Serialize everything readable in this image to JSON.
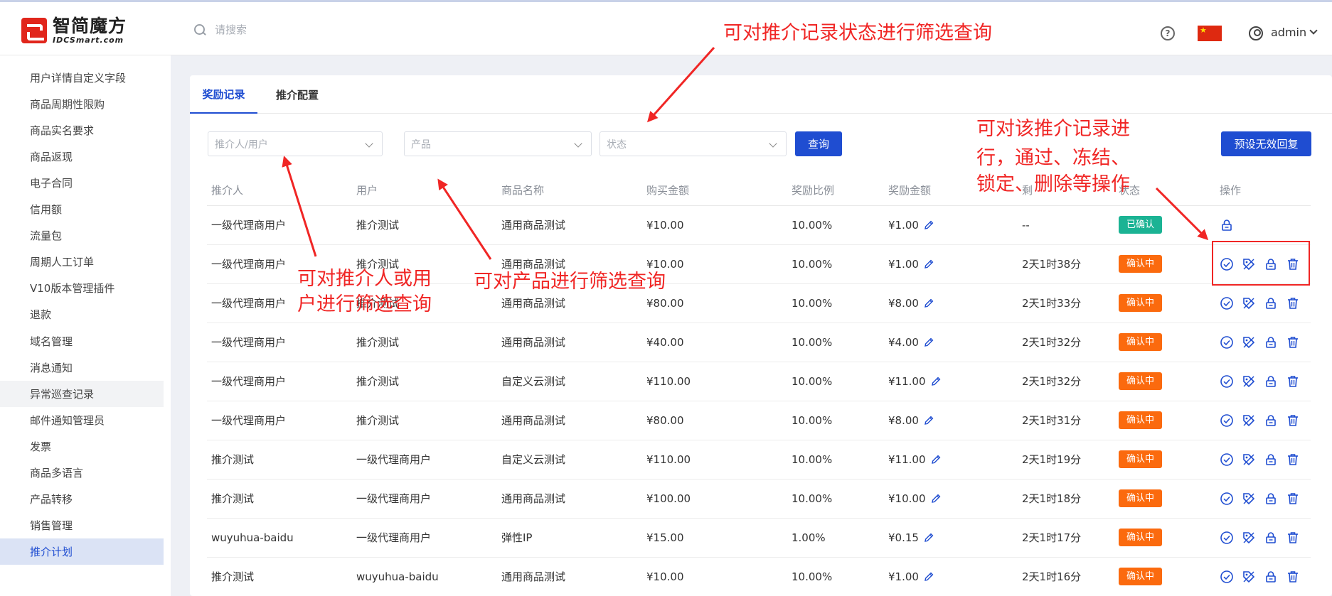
{
  "brand": {
    "name_cn": "智简魔方",
    "name_en": "IDCSmart.com"
  },
  "search": {
    "placeholder": "请搜索"
  },
  "header": {
    "username": "admin",
    "help_icon": "question-circle-icon",
    "language_flag": "china-flag-icon"
  },
  "sidebar": {
    "items": [
      {
        "label": "用户详情自定义字段"
      },
      {
        "label": "商品周期性限购"
      },
      {
        "label": "商品实名要求"
      },
      {
        "label": "商品返现"
      },
      {
        "label": "电子合同"
      },
      {
        "label": "信用额"
      },
      {
        "label": "流量包"
      },
      {
        "label": "周期人工订单"
      },
      {
        "label": "V10版本管理插件"
      },
      {
        "label": "退款"
      },
      {
        "label": "域名管理"
      },
      {
        "label": "消息通知"
      },
      {
        "label": "异常巡查记录"
      },
      {
        "label": "邮件通知管理员"
      },
      {
        "label": "发票"
      },
      {
        "label": "商品多语言"
      },
      {
        "label": "产品转移"
      },
      {
        "label": "销售管理"
      },
      {
        "label": "推介计划"
      }
    ],
    "hovered": "异常巡查记录",
    "active": "推介计划"
  },
  "tabs": [
    {
      "label": "奖励记录",
      "active": true
    },
    {
      "label": "推介配置",
      "active": false
    }
  ],
  "filters": {
    "referrer_placeholder": "推介人/用户",
    "product_placeholder": "产品",
    "status_placeholder": "状态",
    "query_button": "查询",
    "preset_button": "预设无效回复"
  },
  "table": {
    "columns": [
      "推介人",
      "用户",
      "商品名称",
      "购买金额",
      "奖励比例",
      "奖励金额",
      "剩",
      "状态",
      "操作"
    ],
    "rows": [
      {
        "referrer": "一级代理商用户",
        "user": "推介测试",
        "product": "通用商品测试",
        "amount": "¥10.00",
        "ratio": "10.00%",
        "reward": "¥1.00",
        "remaining": "--",
        "status": "已确认",
        "status_type": "ok",
        "actions": [
          "lock"
        ]
      },
      {
        "referrer": "一级代理商用户",
        "user": "推介测试",
        "product": "通用商品测试",
        "amount": "¥10.00",
        "ratio": "10.00%",
        "reward": "¥1.00",
        "remaining": "2天1时38分",
        "status": "确认中",
        "status_type": "pending",
        "actions": [
          "check",
          "tag",
          "lock",
          "trash"
        ]
      },
      {
        "referrer": "一级代理商用户",
        "user": "推介测试",
        "product": "通用商品测试",
        "amount": "¥80.00",
        "ratio": "10.00%",
        "reward": "¥8.00",
        "remaining": "2天1时33分",
        "status": "确认中",
        "status_type": "pending",
        "actions": [
          "check",
          "tag",
          "lock",
          "trash"
        ]
      },
      {
        "referrer": "一级代理商用户",
        "user": "推介测试",
        "product": "通用商品测试",
        "amount": "¥40.00",
        "ratio": "10.00%",
        "reward": "¥4.00",
        "remaining": "2天1时32分",
        "status": "确认中",
        "status_type": "pending",
        "actions": [
          "check",
          "tag",
          "lock",
          "trash"
        ]
      },
      {
        "referrer": "一级代理商用户",
        "user": "推介测试",
        "product": "自定义云测试",
        "amount": "¥110.00",
        "ratio": "10.00%",
        "reward": "¥11.00",
        "remaining": "2天1时32分",
        "status": "确认中",
        "status_type": "pending",
        "actions": [
          "check",
          "tag",
          "lock",
          "trash"
        ]
      },
      {
        "referrer": "一级代理商用户",
        "user": "推介测试",
        "product": "通用商品测试",
        "amount": "¥80.00",
        "ratio": "10.00%",
        "reward": "¥8.00",
        "remaining": "2天1时31分",
        "status": "确认中",
        "status_type": "pending",
        "actions": [
          "check",
          "tag",
          "lock",
          "trash"
        ]
      },
      {
        "referrer": "推介测试",
        "user": "一级代理商用户",
        "product": "自定义云测试",
        "amount": "¥110.00",
        "ratio": "10.00%",
        "reward": "¥11.00",
        "remaining": "2天1时19分",
        "status": "确认中",
        "status_type": "pending",
        "actions": [
          "check",
          "tag",
          "lock",
          "trash"
        ]
      },
      {
        "referrer": "推介测试",
        "user": "一级代理商用户",
        "product": "通用商品测试",
        "amount": "¥100.00",
        "ratio": "10.00%",
        "reward": "¥10.00",
        "remaining": "2天1时18分",
        "status": "确认中",
        "status_type": "pending",
        "actions": [
          "check",
          "tag",
          "lock",
          "trash"
        ]
      },
      {
        "referrer": "wuyuhua-baidu",
        "user": "一级代理商用户",
        "product": "弹性IP",
        "amount": "¥15.00",
        "ratio": "1.00%",
        "reward": "¥0.15",
        "remaining": "2天1时17分",
        "status": "确认中",
        "status_type": "pending",
        "actions": [
          "check",
          "tag",
          "lock",
          "trash"
        ]
      },
      {
        "referrer": "推介测试",
        "user": "wuyuhua-baidu",
        "product": "通用商品测试",
        "amount": "¥10.00",
        "ratio": "10.00%",
        "reward": "¥1.00",
        "remaining": "2天1时16分",
        "status": "确认中",
        "status_type": "pending",
        "actions": [
          "check",
          "tag",
          "lock",
          "trash"
        ]
      }
    ]
  },
  "annotations": {
    "status_filter": "可对推介记录状态进行筛选查询",
    "referrer_filter_line1": "可对推介人或用",
    "referrer_filter_line2": "户进行筛选查询",
    "product_filter": "可对产品进行筛选查询",
    "actions_line1": "可对该推介记录进",
    "actions_line2": "行，通过、冻结、",
    "actions_line3": "锁定、删除等操作",
    "color": "#f02625"
  },
  "colors": {
    "primary": "#1f4dd1",
    "success": "#1bb394",
    "warning": "#fb6a0e",
    "annotation": "#f02625"
  }
}
